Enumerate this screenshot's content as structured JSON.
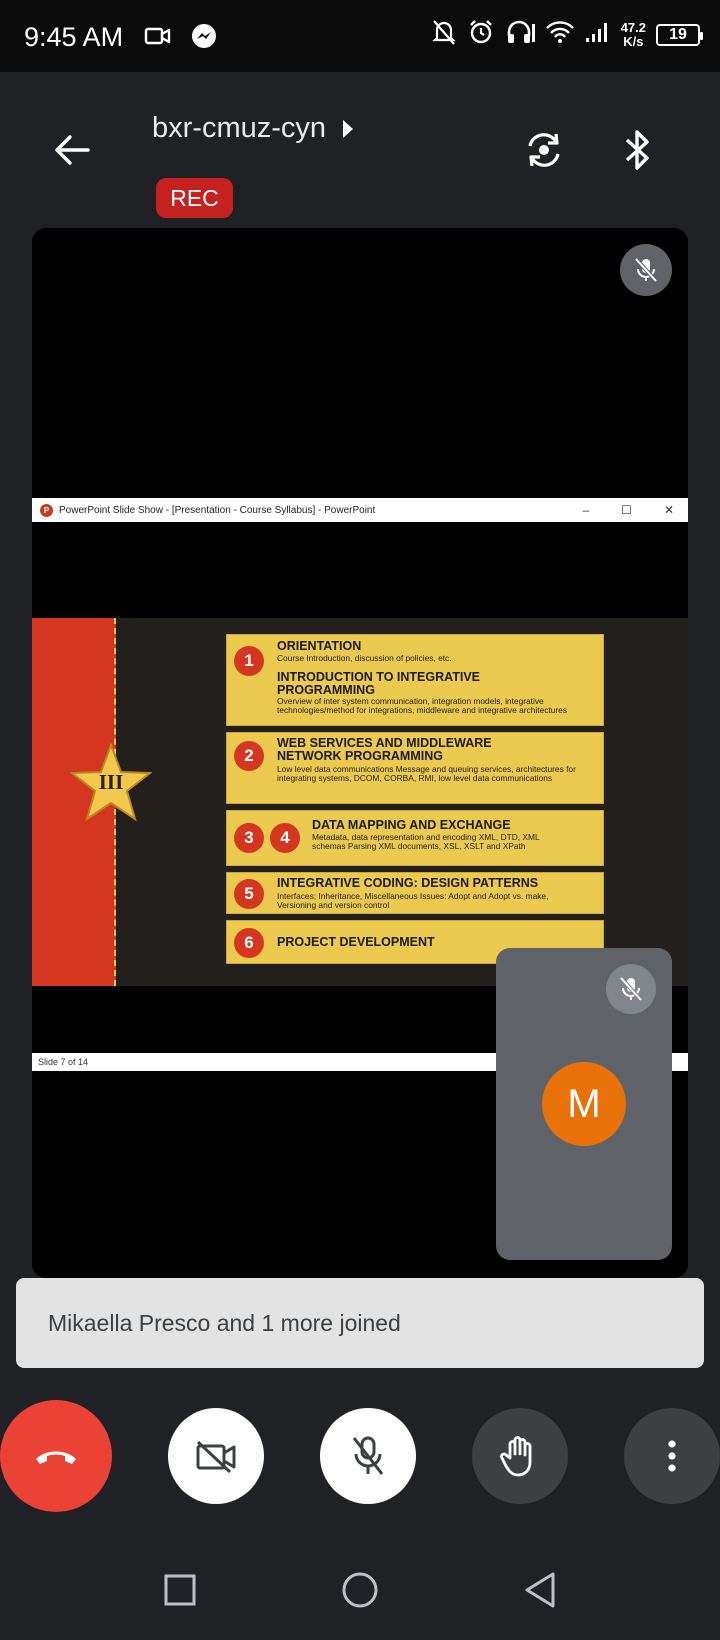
{
  "status_bar": {
    "time": "9:45 AM",
    "netspeed_value": "47.2",
    "netspeed_unit": "K/s",
    "battery": "19"
  },
  "header": {
    "meeting_code": "bxr-cmuz-cyn",
    "rec_label": "REC"
  },
  "shared_screen": {
    "window_title": "PowerPoint Slide Show - [Presentation - Course Syllabus] - PowerPoint",
    "window_buttons": [
      "–",
      "☐",
      "✕"
    ],
    "slide_status": "Slide 7 of 14",
    "slide": {
      "section_numeral": "III",
      "cards": [
        {
          "numbers": [
            "1"
          ],
          "title": "ORIENTATION",
          "desc": "Course Introduction, discussion of policies, etc.",
          "title2": "INTRODUCTION TO INTEGRATIVE PROGRAMMING",
          "desc2": "Overview of inter system communication, integration models, integrative technologies/method for integrations, middleware and integrative architectures"
        },
        {
          "numbers": [
            "2"
          ],
          "title": "WEB SERVICES AND MIDDLEWARE NETWORK PROGRAMMING",
          "desc": "Low level data communications Message and queuing services, architectures for integrating systems, DCOM, CORBA, RMI, low level data communications"
        },
        {
          "numbers": [
            "3",
            "4"
          ],
          "title": "DATA MAPPING AND EXCHANGE",
          "desc": "Metadata, data representation and encoding XML, DTD, XML schemas Parsing XML documents, XSL, XSLT and XPath"
        },
        {
          "numbers": [
            "5"
          ],
          "title": "INTEGRATIVE CODING: DESIGN PATTERNS",
          "desc": "Interfaces; Inheritance, Miscellaneous Issues: Adopt and Adopt vs. make, Versioning and version control"
        },
        {
          "numbers": [
            "6"
          ],
          "title": "PROJECT DEVELOPMENT",
          "desc": ""
        }
      ]
    }
  },
  "self_tile": {
    "avatar_initial": "M",
    "avatar_color": "#e8710a"
  },
  "toast": {
    "message": "Mikaella Presco and 1 more joined"
  },
  "colors": {
    "end_call": "#ea4335",
    "rec": "#c5221f",
    "slide_accent": "#d4361f",
    "card_fill": "#ecc94f"
  }
}
